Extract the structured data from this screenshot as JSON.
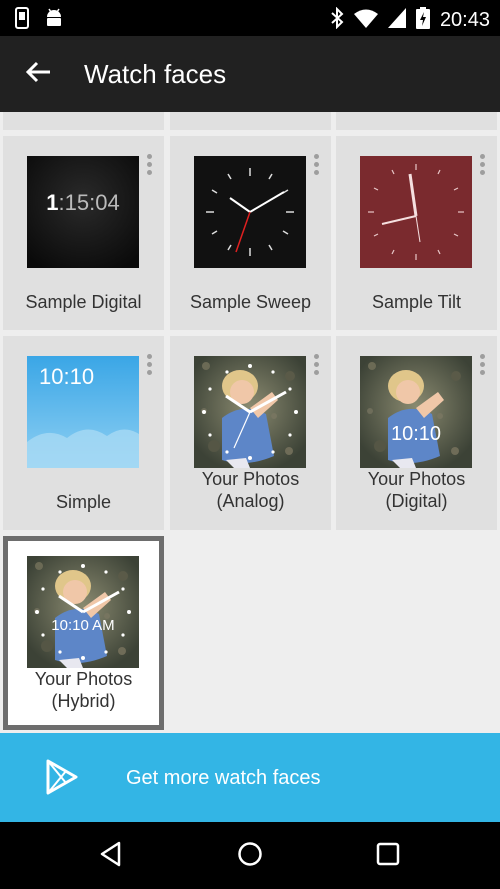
{
  "status_bar": {
    "time": "20:43"
  },
  "app_bar": {
    "title": "Watch faces"
  },
  "faces": [
    {
      "label": "Sample Digital",
      "preview_text_hours": "1",
      "preview_text_rest": ":15:04"
    },
    {
      "label": "Sample Sweep"
    },
    {
      "label": "Sample Tilt"
    },
    {
      "label": "Simple",
      "preview_text": "10:10"
    },
    {
      "label": "Your Photos\n(Analog)"
    },
    {
      "label": "Your Photos\n(Digital)",
      "preview_text": "10:10"
    },
    {
      "label": "Your Photos\n(Hybrid)",
      "preview_text": "10:10 AM",
      "selected": true
    }
  ],
  "banner": {
    "label": "Get more watch faces"
  },
  "colors": {
    "app_bar": "#212121",
    "accent": "#33b5e5",
    "cell_bg": "#e0e0e0",
    "tilt_red": "#7a2a2e"
  },
  "icons": [
    "phone-icon",
    "android-icon",
    "bluetooth-icon",
    "wifi-icon",
    "battery-icon",
    "back-arrow-icon",
    "overflow-menu-icon",
    "play-store-icon",
    "nav-back-icon",
    "nav-home-icon",
    "nav-recents-icon"
  ]
}
